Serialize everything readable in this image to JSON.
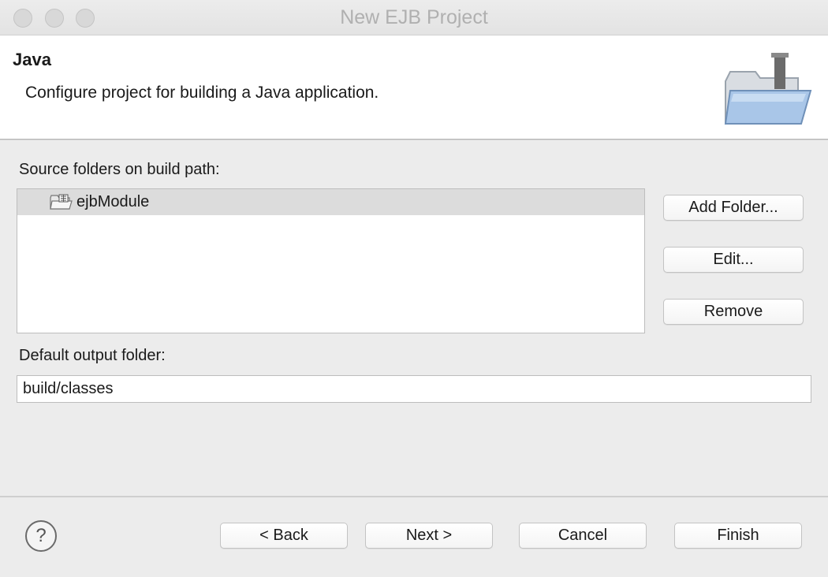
{
  "window": {
    "title": "New EJB Project"
  },
  "banner": {
    "title": "Java",
    "description": "Configure project for building a Java application."
  },
  "source_folders": {
    "label": "Source folders on build path:",
    "items": [
      {
        "label": "ejbModule",
        "icon": "source-folder-icon"
      }
    ],
    "buttons": {
      "add": "Add Folder...",
      "edit": "Edit...",
      "remove": "Remove"
    }
  },
  "output_folder": {
    "label": "Default output folder:",
    "value": "build/classes"
  },
  "footer": {
    "help_icon": "?",
    "back": "< Back",
    "next": "Next >",
    "cancel": "Cancel",
    "finish": "Finish"
  }
}
